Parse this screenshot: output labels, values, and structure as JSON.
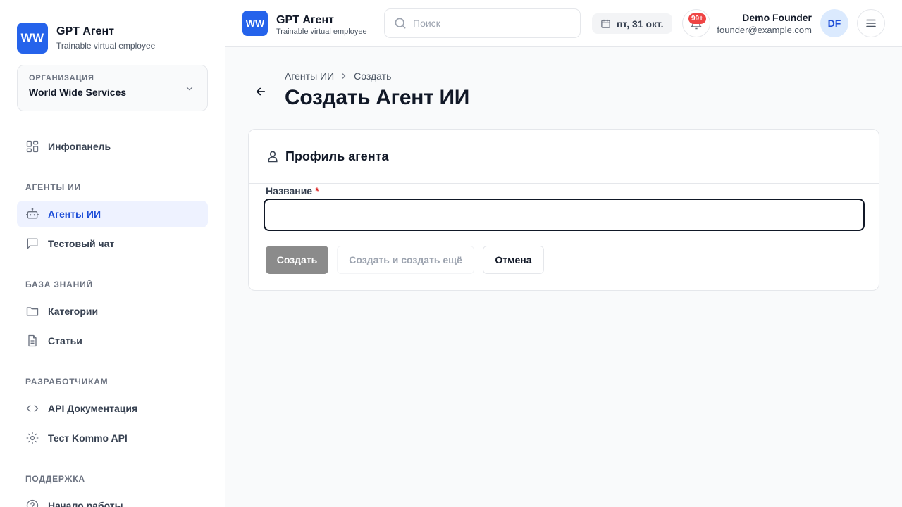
{
  "sidebar": {
    "logo": "WW",
    "title": "GPT Агент",
    "subtitle": "Trainable virtual employee",
    "org": {
      "label": "ОРГАНИЗАЦИЯ",
      "name": "World Wide Services"
    },
    "items": {
      "dashboard": "Инфопанель",
      "agents": "Агенты ИИ",
      "test_chat": "Тестовый чат",
      "categories": "Категории",
      "articles": "Статьи",
      "api_docs": "API Документация",
      "kommo": "Тест Kommo API",
      "getting_started": "Начало работы"
    },
    "sections": {
      "agents": "АГЕНТЫ ИИ",
      "knowledge": "БАЗА ЗНАНИЙ",
      "developers": "РАЗРАБОТЧИКАМ",
      "support": "ПОДДЕРЖКА"
    }
  },
  "header": {
    "logo": "WW",
    "title": "GPT Агент",
    "subtitle": "Trainable virtual employee",
    "search_placeholder": "Поиск",
    "date": "пт, 31 окт.",
    "notifications_badge": "99+",
    "user_name": "Demo Founder",
    "user_email": "founder@example.com",
    "avatar_initials": "DF"
  },
  "main": {
    "breadcrumb": [
      "Агенты ИИ",
      "Создать"
    ],
    "title": "Создать Агент ИИ",
    "card_title": "Профиль агента",
    "field_label": "Название",
    "required_mark": "*",
    "field_value": "",
    "buttons": {
      "create": "Создать",
      "create_another": "Создать и создать ещё",
      "cancel": "Отмена"
    }
  },
  "colors": {
    "accent": "#2563eb",
    "active_bg": "#eef2ff",
    "badge": "#ef4444"
  }
}
